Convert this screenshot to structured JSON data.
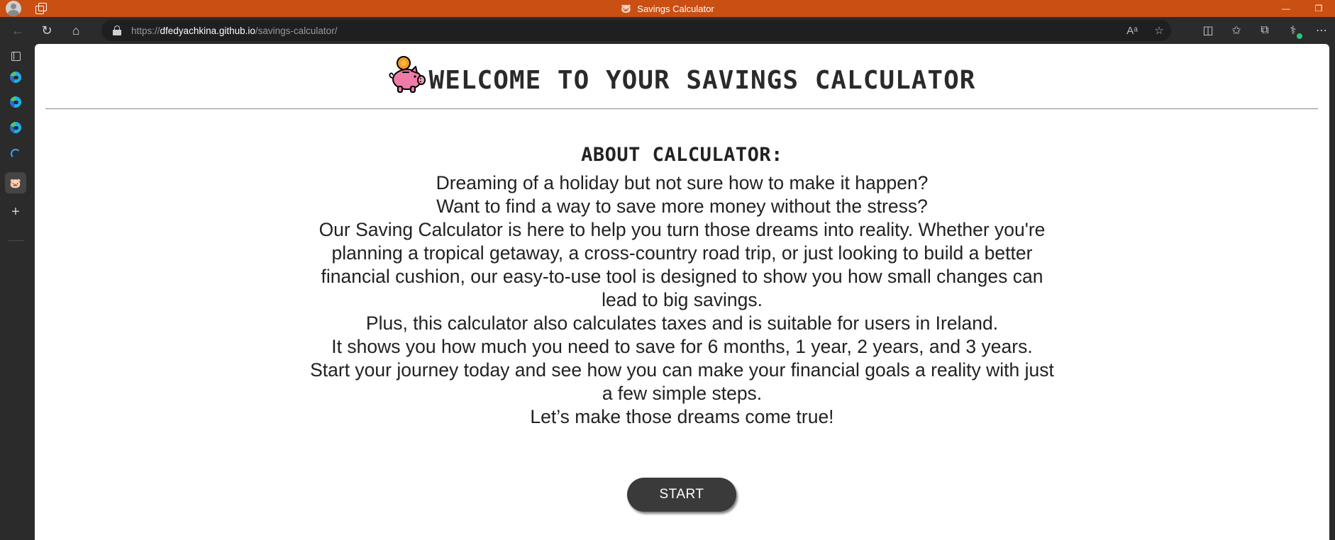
{
  "window": {
    "title": "Savings Calculator",
    "favicon": "piggy-bank-icon",
    "controls": {
      "minimize": "—",
      "restore": "❐"
    }
  },
  "toolbar": {
    "url_prefix": "https://",
    "url_host": "dfedyachkina.github.io",
    "url_path": "/savings-calculator/",
    "back_icon": "←",
    "refresh_icon": "↻",
    "home_icon": "⌂",
    "read_aloud_icon": "Aᵃ",
    "favorite_icon": "☆",
    "split_screen_icon": "◫",
    "favorites_icon": "✩",
    "collections_icon": "⧉",
    "copilot_icon": "⚕",
    "more_icon": "⋯"
  },
  "sidebar": {
    "tabs": [
      {
        "name": "tab-actions",
        "icon": "tab-panel-icon"
      },
      {
        "name": "tab-edge-1",
        "icon": "edge-icon"
      },
      {
        "name": "tab-edge-2",
        "icon": "edge-icon"
      },
      {
        "name": "tab-edge-3",
        "icon": "edge-icon"
      },
      {
        "name": "tab-loading",
        "icon": "loading-icon"
      },
      {
        "name": "tab-savings-calculator",
        "icon": "piggy-bank-icon",
        "active": true
      }
    ],
    "new_tab": "+"
  },
  "page": {
    "title": "WELCOME TO YOUR SAVINGS CALCULATOR",
    "about_heading": "ABOUT CALCULATOR:",
    "paragraphs": [
      "Dreaming of a holiday but not sure how to make it happen?",
      "Want to find a way to save more money without the stress?",
      "Our Saving Calculator is here to help you turn those dreams into reality. Whether you're planning a tropical getaway, a cross-country road trip, or just looking to build a better financial cushion, our easy-to-use tool is designed to show you how small changes can lead to big savings.",
      "Plus, this calculator also calculates taxes and is suitable for users in Ireland.",
      "It shows you how much you need to save for 6 months, 1 year, 2 years, and 3 years.",
      "Start your journey today and see how you can make your financial goals a reality with just a few simple steps.",
      "Let’s make those dreams come true!"
    ],
    "start_button": "START"
  },
  "colors": {
    "titlebar": "#c94f13",
    "chrome": "#2b2b2b",
    "button": "#3a3a3a",
    "piggy": "#f07aa8",
    "coin": "#f39a1f"
  }
}
